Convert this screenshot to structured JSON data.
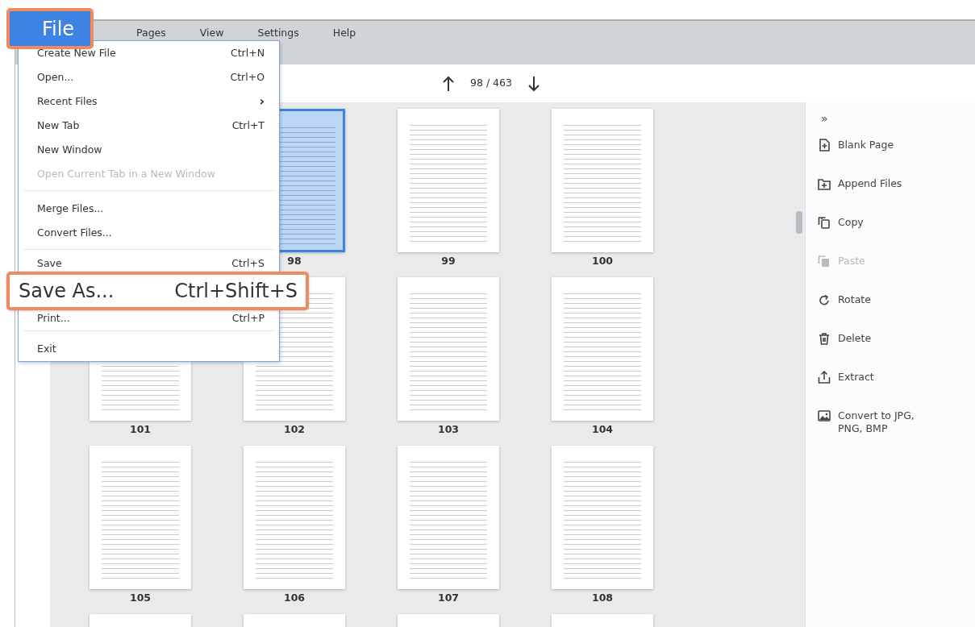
{
  "menubar": [
    {
      "label": "File",
      "selected": true
    },
    {
      "label": "Pages",
      "selected": false
    },
    {
      "label": "View",
      "selected": false
    },
    {
      "label": "Settings",
      "selected": false
    },
    {
      "label": "Help",
      "selected": false
    }
  ],
  "file_menu": [
    {
      "kind": "item",
      "label": "Create New File",
      "shortcut": "Ctrl+N",
      "disabled": false,
      "highlighted": false
    },
    {
      "kind": "item",
      "label": "Open...",
      "shortcut": "Ctrl+O",
      "disabled": false,
      "highlighted": false
    },
    {
      "kind": "submenu",
      "label": "Recent Files",
      "arrow": "›",
      "disabled": false,
      "highlighted": false
    },
    {
      "kind": "item",
      "label": "New Tab",
      "shortcut": "Ctrl+T",
      "disabled": false,
      "highlighted": false
    },
    {
      "kind": "item",
      "label": "New Window",
      "disabled": false,
      "highlighted": false
    },
    {
      "kind": "item",
      "label": "Open Current Tab in a New Window",
      "disabled": true,
      "highlighted": false
    },
    {
      "kind": "separator"
    },
    {
      "kind": "item",
      "label": "Merge Files...",
      "disabled": false,
      "highlighted": false
    },
    {
      "kind": "item",
      "label": "Convert Files...",
      "disabled": false,
      "highlighted": false
    },
    {
      "kind": "separator"
    },
    {
      "kind": "item",
      "label": "Save",
      "shortcut": "Ctrl+S",
      "disabled": false,
      "highlighted": false
    },
    {
      "kind": "item",
      "label": "Save As...",
      "shortcut": "Ctrl+Shift+S",
      "disabled": false,
      "highlighted": true
    },
    {
      "kind": "item",
      "label": "Print...",
      "shortcut": "Ctrl+P",
      "disabled": false,
      "highlighted": false
    },
    {
      "kind": "separator"
    },
    {
      "kind": "item",
      "label": "Exit",
      "disabled": false,
      "highlighted": false
    }
  ],
  "pager": {
    "current": "98 / 463"
  },
  "thumbnails": [
    {
      "page": "98",
      "selected": true
    },
    {
      "page": "99",
      "selected": false
    },
    {
      "page": "100",
      "selected": false
    },
    {
      "page": "101",
      "selected": false
    },
    {
      "page": "102",
      "selected": false
    },
    {
      "page": "103",
      "selected": false
    },
    {
      "page": "104",
      "selected": false
    },
    {
      "page": "105",
      "selected": false
    },
    {
      "page": "106",
      "selected": false
    },
    {
      "page": "107",
      "selected": false
    },
    {
      "page": "108",
      "selected": false
    },
    {
      "selected": false
    },
    {
      "selected": false
    },
    {
      "selected": false
    },
    {
      "selected": false
    }
  ],
  "side_panel": {
    "collapse": "»",
    "actions": [
      {
        "kind": "blank",
        "label": "Blank Page",
        "disabled": false
      },
      {
        "kind": "append",
        "label": "Append Files",
        "disabled": false
      },
      {
        "kind": "copy",
        "label": "Copy",
        "disabled": false
      },
      {
        "kind": "paste",
        "label": "Paste",
        "disabled": true
      },
      {
        "kind": "rotate",
        "label": "Rotate",
        "disabled": false
      },
      {
        "kind": "delete",
        "label": "Delete",
        "disabled": false
      },
      {
        "kind": "extract",
        "label": "Extract",
        "disabled": false
      },
      {
        "kind": "image",
        "label": "Convert to JPG, PNG, BMP",
        "disabled": false
      }
    ]
  }
}
